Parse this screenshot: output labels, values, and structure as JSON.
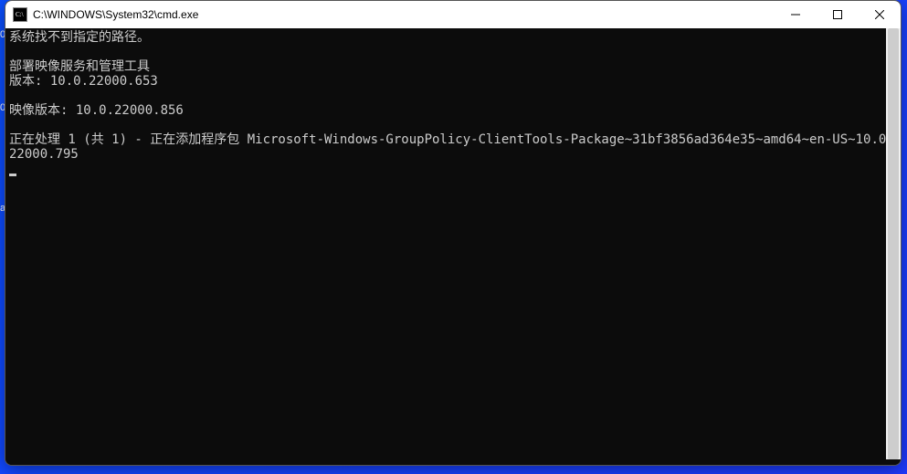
{
  "titlebar": {
    "title": "C:\\WINDOWS\\System32\\cmd.exe"
  },
  "sideLabels": {
    "l1": "0",
    "l2": "0.",
    "l3": "a"
  },
  "console": {
    "line1": "系统找不到指定的路径。",
    "line2": "",
    "line3": "部署映像服务和管理工具",
    "line4": "版本: 10.0.22000.653",
    "line5": "",
    "line6": "映像版本: 10.0.22000.856",
    "line7": "",
    "line8": "正在处理 1 (共 1) - 正在添加程序包 Microsoft-Windows-GroupPolicy-ClientTools-Package~31bf3856ad364e35~amd64~en-US~10.0.22000.795"
  }
}
